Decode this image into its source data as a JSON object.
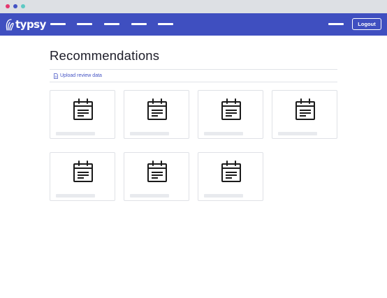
{
  "window": {
    "controls": [
      "close-dot",
      "minimize-dot",
      "maximize-dot"
    ],
    "colors": {
      "close": "#e5386f",
      "minimize": "#4453c4",
      "maximize": "#5ec9c4"
    }
  },
  "navbar": {
    "logo_text": "typsy",
    "background": "#3f4fc0",
    "nav_items_count": 6,
    "logout_label": "Logout"
  },
  "main": {
    "title": "Recommendations",
    "upload_link": {
      "icon": "document-icon",
      "label": "Upload review data"
    },
    "cards": [
      {
        "icon": "clipboard-icon"
      },
      {
        "icon": "clipboard-icon"
      },
      {
        "icon": "clipboard-icon"
      },
      {
        "icon": "clipboard-icon"
      },
      {
        "icon": "clipboard-icon"
      },
      {
        "icon": "clipboard-icon"
      },
      {
        "icon": "clipboard-icon"
      }
    ]
  }
}
